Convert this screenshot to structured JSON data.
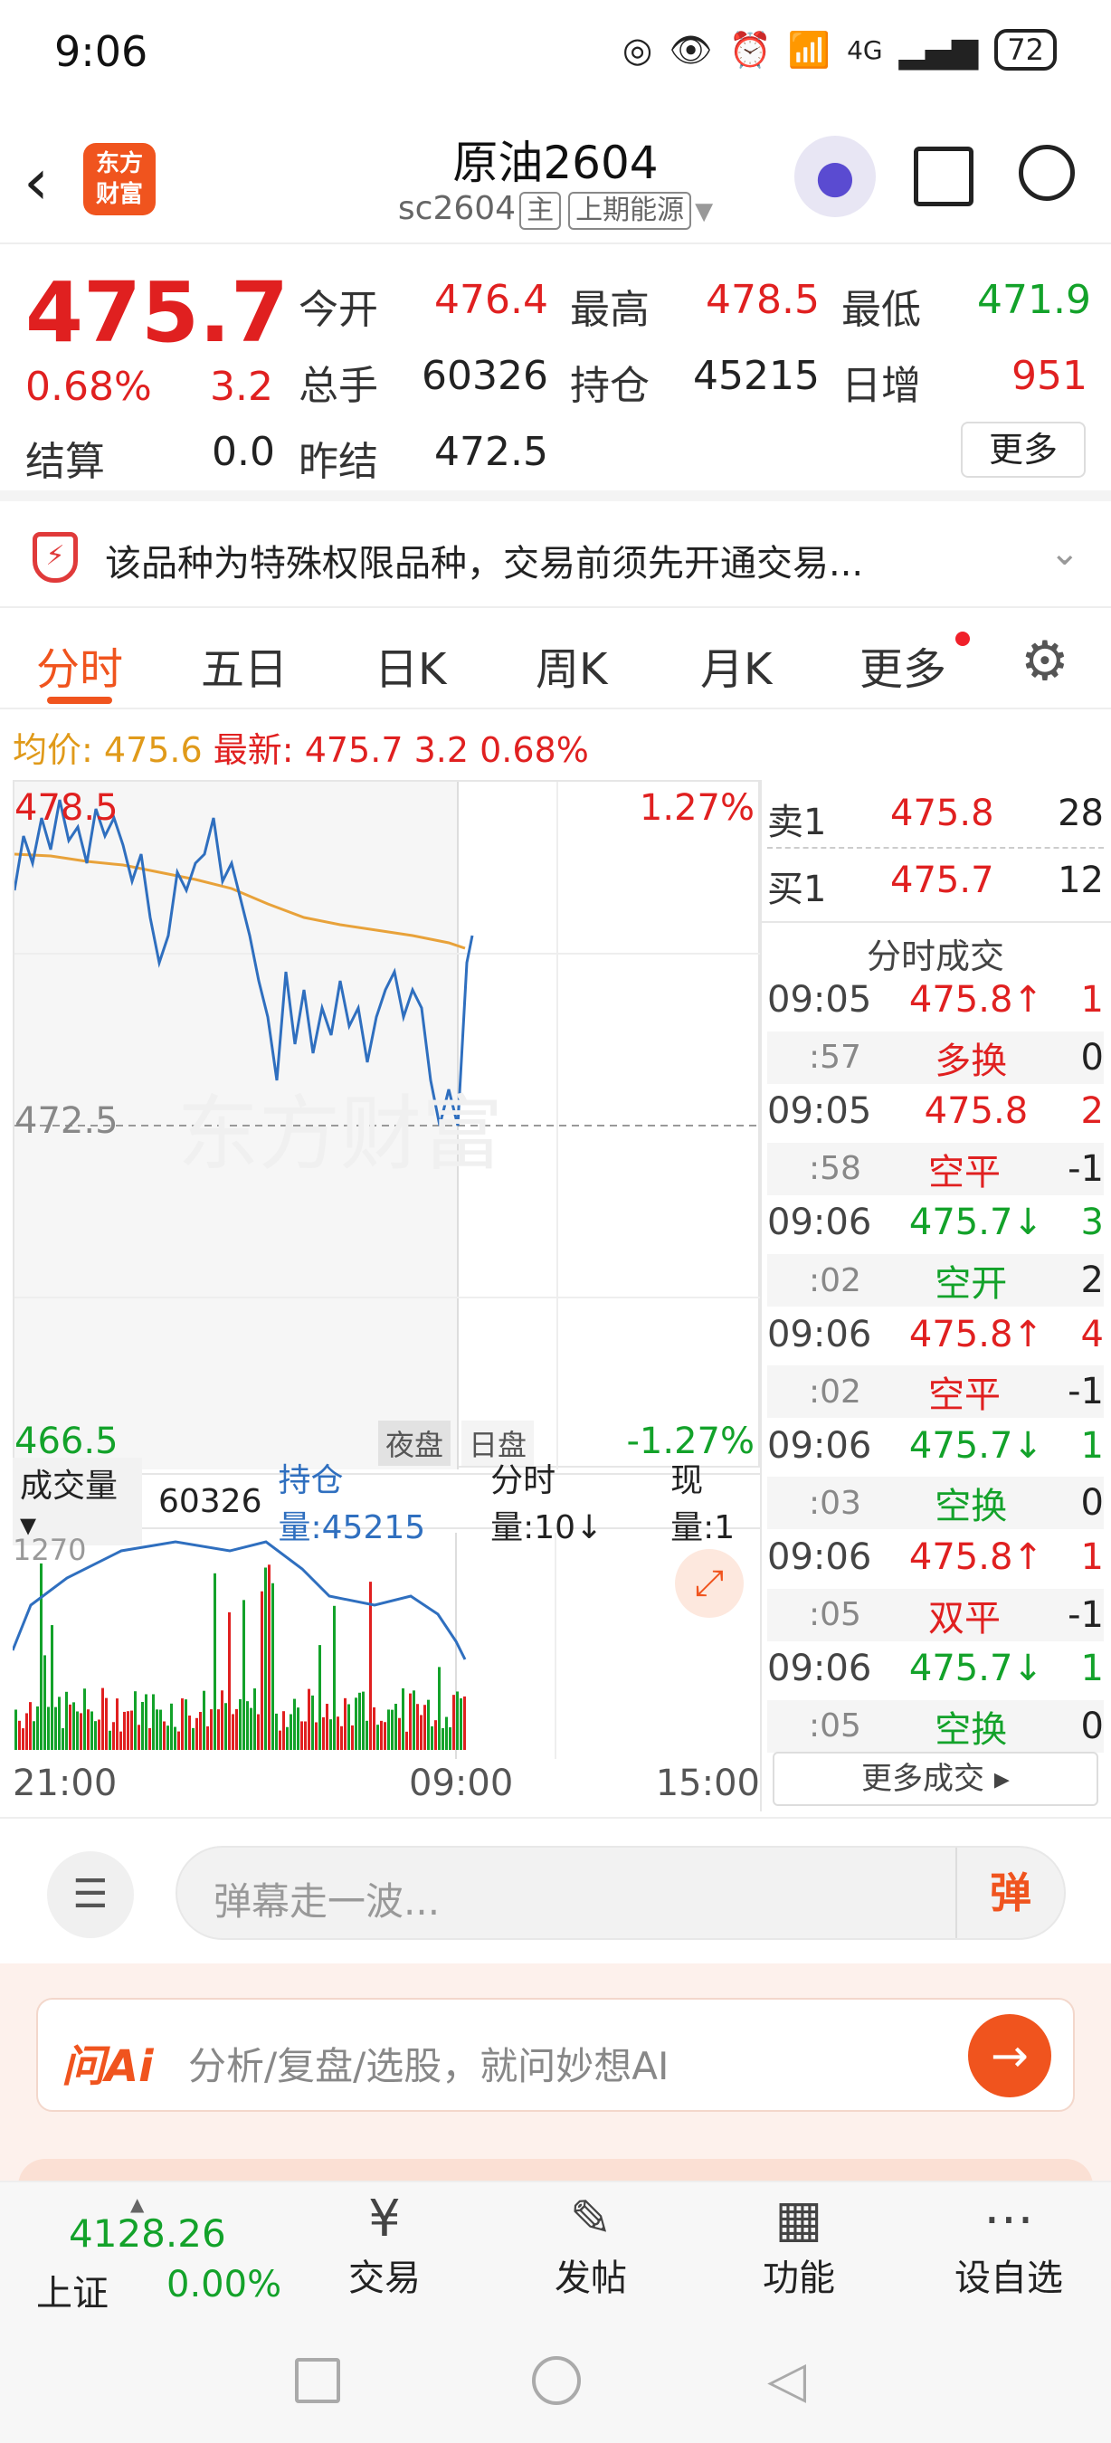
{
  "status_bar": {
    "time": "9:06",
    "battery": "72",
    "network": "4G"
  },
  "header": {
    "title": "原油2604",
    "code": "sc2604",
    "main_tag": "主",
    "exchange_tag": "上期能源",
    "logo_text_1": "东方",
    "logo_text_2": "财富",
    "icons": [
      "back-icon",
      "robot-avatar-icon",
      "share-icon",
      "search-icon"
    ]
  },
  "quote": {
    "price": "475.7",
    "change_pct": "0.68%",
    "change": "3.2",
    "settle_label": "结算",
    "settle_value": "0.0",
    "open_label": "今开",
    "open_value": "476.4",
    "high_label": "最高",
    "high_value": "478.5",
    "low_label": "最低",
    "low_value": "471.9",
    "volume_label": "总手",
    "volume_value": "60326",
    "oi_label": "持仓",
    "oi_value": "45215",
    "daily_inc_label": "日增",
    "daily_inc_value": "951",
    "prev_settle_label": "昨结",
    "prev_settle_value": "472.5",
    "more_label": "更多",
    "colors": {
      "up": "#e02020",
      "down": "#13a22a",
      "accent": "#f0541e"
    }
  },
  "notice": {
    "text": "该品种为特殊权限品种，交易前须先开通交易..."
  },
  "tabs": [
    "分时",
    "五日",
    "日K",
    "周K",
    "月K",
    "更多"
  ],
  "active_tab": "分时",
  "summary": {
    "avg_label": "均价:",
    "avg_value": "475.6",
    "latest_label": "最新:",
    "latest_value": "475.7",
    "latest_change": "3.2",
    "latest_pct": "0.68%"
  },
  "chart": {
    "top_price": "478.5",
    "bottom_price": "466.5",
    "ref_price": "472.5",
    "top_pct": "1.27%",
    "bottom_pct": "-1.27%",
    "night_label": "夜盘",
    "day_label": "日盘",
    "watermark": "东方财富",
    "vol_max": "1270",
    "x_start": "21:00",
    "x_mid": "09:00",
    "x_end": "15:00"
  },
  "volume_bar": {
    "label": "成交量",
    "value": "60326",
    "oi_label": "持仓量:45215",
    "tick_label": "分时量:10↓",
    "now_label": "现量:1"
  },
  "order_book": {
    "sell1_label": "卖1",
    "sell1_price": "475.8",
    "sell1_qty": "28",
    "buy1_label": "买1",
    "buy1_price": "475.7",
    "buy1_qty": "12",
    "ticks_title": "分时成交",
    "ticks": [
      {
        "time": "09:05",
        "price": "475.8↑",
        "qty": "1",
        "dir": "up",
        "sec": ":57",
        "type": "多换",
        "delta": "0"
      },
      {
        "time": "09:05",
        "price": "475.8",
        "qty": "2",
        "dir": "up",
        "sec": ":58",
        "type": "空平",
        "delta": "-1"
      },
      {
        "time": "09:06",
        "price": "475.7↓",
        "qty": "3",
        "dir": "down",
        "sec": ":02",
        "type": "空开",
        "delta": "2"
      },
      {
        "time": "09:06",
        "price": "475.8↑",
        "qty": "4",
        "dir": "up",
        "sec": ":02",
        "type": "空平",
        "delta": "-1"
      },
      {
        "time": "09:06",
        "price": "475.7↓",
        "qty": "1",
        "dir": "down",
        "sec": ":03",
        "type": "空换",
        "delta": "0"
      },
      {
        "time": "09:06",
        "price": "475.8↑",
        "qty": "1",
        "dir": "up",
        "sec": ":05",
        "type": "双平",
        "delta": "-1"
      },
      {
        "time": "09:06",
        "price": "475.7↓",
        "qty": "1",
        "dir": "down",
        "sec": ":05",
        "type": "空换",
        "delta": "0"
      }
    ],
    "more_ticks": "更多成交"
  },
  "comment": {
    "placeholder": "弹幕走一波...",
    "danmu_button": "弹"
  },
  "ai": {
    "logo": "问Ai",
    "placeholder": "分析/复盘/选股，就问妙想AI"
  },
  "bottom_nav": {
    "index_value": "4128.26",
    "index_name": "上证",
    "index_pct": "0.00%",
    "items": [
      "交易",
      "发帖",
      "功能",
      "设自选"
    ]
  }
}
